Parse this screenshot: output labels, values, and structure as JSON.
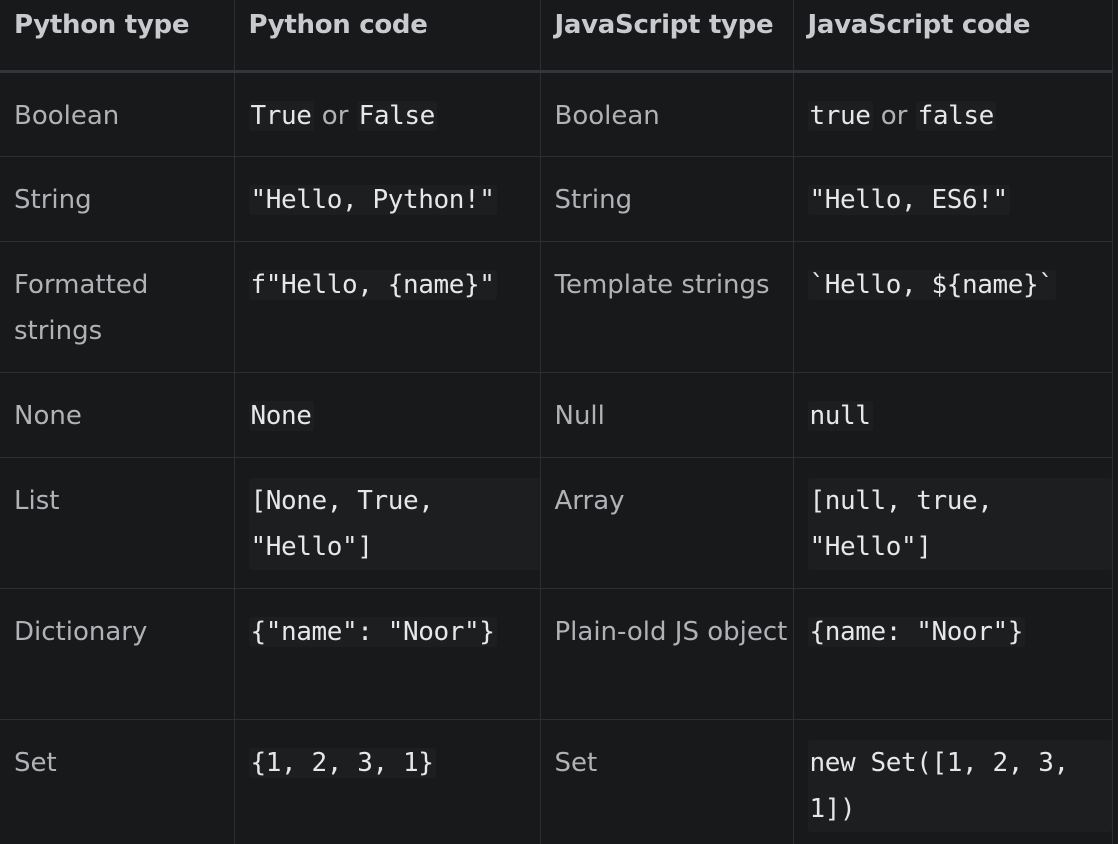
{
  "table": {
    "headers": [
      "Python type",
      "Python code",
      "JavaScript type",
      "JavaScript code"
    ],
    "rows": [
      {
        "python_type": "Boolean",
        "python_code_a": "True",
        "python_code_or": "or",
        "python_code_b": "False",
        "js_type": "Boolean",
        "js_code_a": "true",
        "js_code_or": "or",
        "js_code_b": "false"
      },
      {
        "python_type": "String",
        "python_code": "\"Hello, Python!\"",
        "js_type": "String",
        "js_code": "\"Hello, ES6!\""
      },
      {
        "python_type": "Formatted strings",
        "python_code": "f\"Hello, {name}\"",
        "js_type": "Template strings",
        "js_code": "`Hello, ${name}`"
      },
      {
        "python_type": "None",
        "python_code": "None",
        "js_type": "Null",
        "js_code": "null"
      },
      {
        "python_type": "List",
        "python_code": "[None, True, \"Hello\"]",
        "js_type": "Array",
        "js_code": "[null, true, \"Hello\"]"
      },
      {
        "python_type": "Dictionary",
        "python_code": "{\"name\": \"Noor\"}",
        "js_type": "Plain-old JS object",
        "js_code": "{name: \"Noor\"}"
      },
      {
        "python_type": "Set",
        "python_code": "{1, 2, 3, 1}",
        "js_type": "Set",
        "js_code": "new Set([1, 2, 3, 1])"
      }
    ]
  }
}
